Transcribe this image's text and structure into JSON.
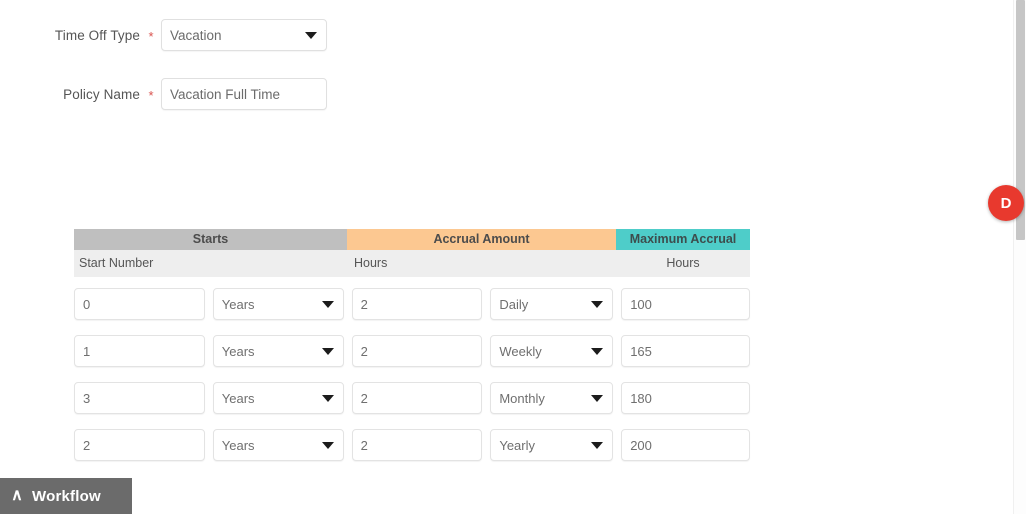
{
  "form": {
    "fields": [
      {
        "label": "Time Off Type",
        "required": "*",
        "value": "Vacation",
        "type": "select",
        "icon": "chevron-down-icon"
      },
      {
        "label": "Policy Name",
        "required": "*",
        "value": "Vacation Full Time",
        "type": "text",
        "icon": ""
      }
    ]
  },
  "accrual_table": {
    "group_headers": [
      {
        "label": "Starts",
        "color": "#bfbfbf"
      },
      {
        "label": "Accrual Amount",
        "color": "#fcc891"
      },
      {
        "label": "Maximum Accrual",
        "color": "#4ecdc9"
      }
    ],
    "sub_headers": [
      "Start Number",
      "Hours",
      "Hours"
    ],
    "rows": [
      {
        "start_number": "0",
        "start_unit": "Years",
        "accrual_amount": "2",
        "accrual_frequency": "Daily",
        "maximum_accrual": "100"
      },
      {
        "start_number": "1",
        "start_unit": "Years",
        "accrual_amount": "2",
        "accrual_frequency": "Weekly",
        "maximum_accrual": "165"
      },
      {
        "start_number": "3",
        "start_unit": "Years",
        "accrual_amount": "2",
        "accrual_frequency": "Monthly",
        "maximum_accrual": "180"
      },
      {
        "start_number": "2",
        "start_unit": "Years",
        "accrual_amount": "2",
        "accrual_frequency": "Yearly",
        "maximum_accrual": "200"
      }
    ]
  },
  "workflow": {
    "label": "Workflow",
    "icon": "chevron-up-icon",
    "expand_glyph": "∧"
  },
  "badge": {
    "initial": "D",
    "color": "#e8392e"
  }
}
